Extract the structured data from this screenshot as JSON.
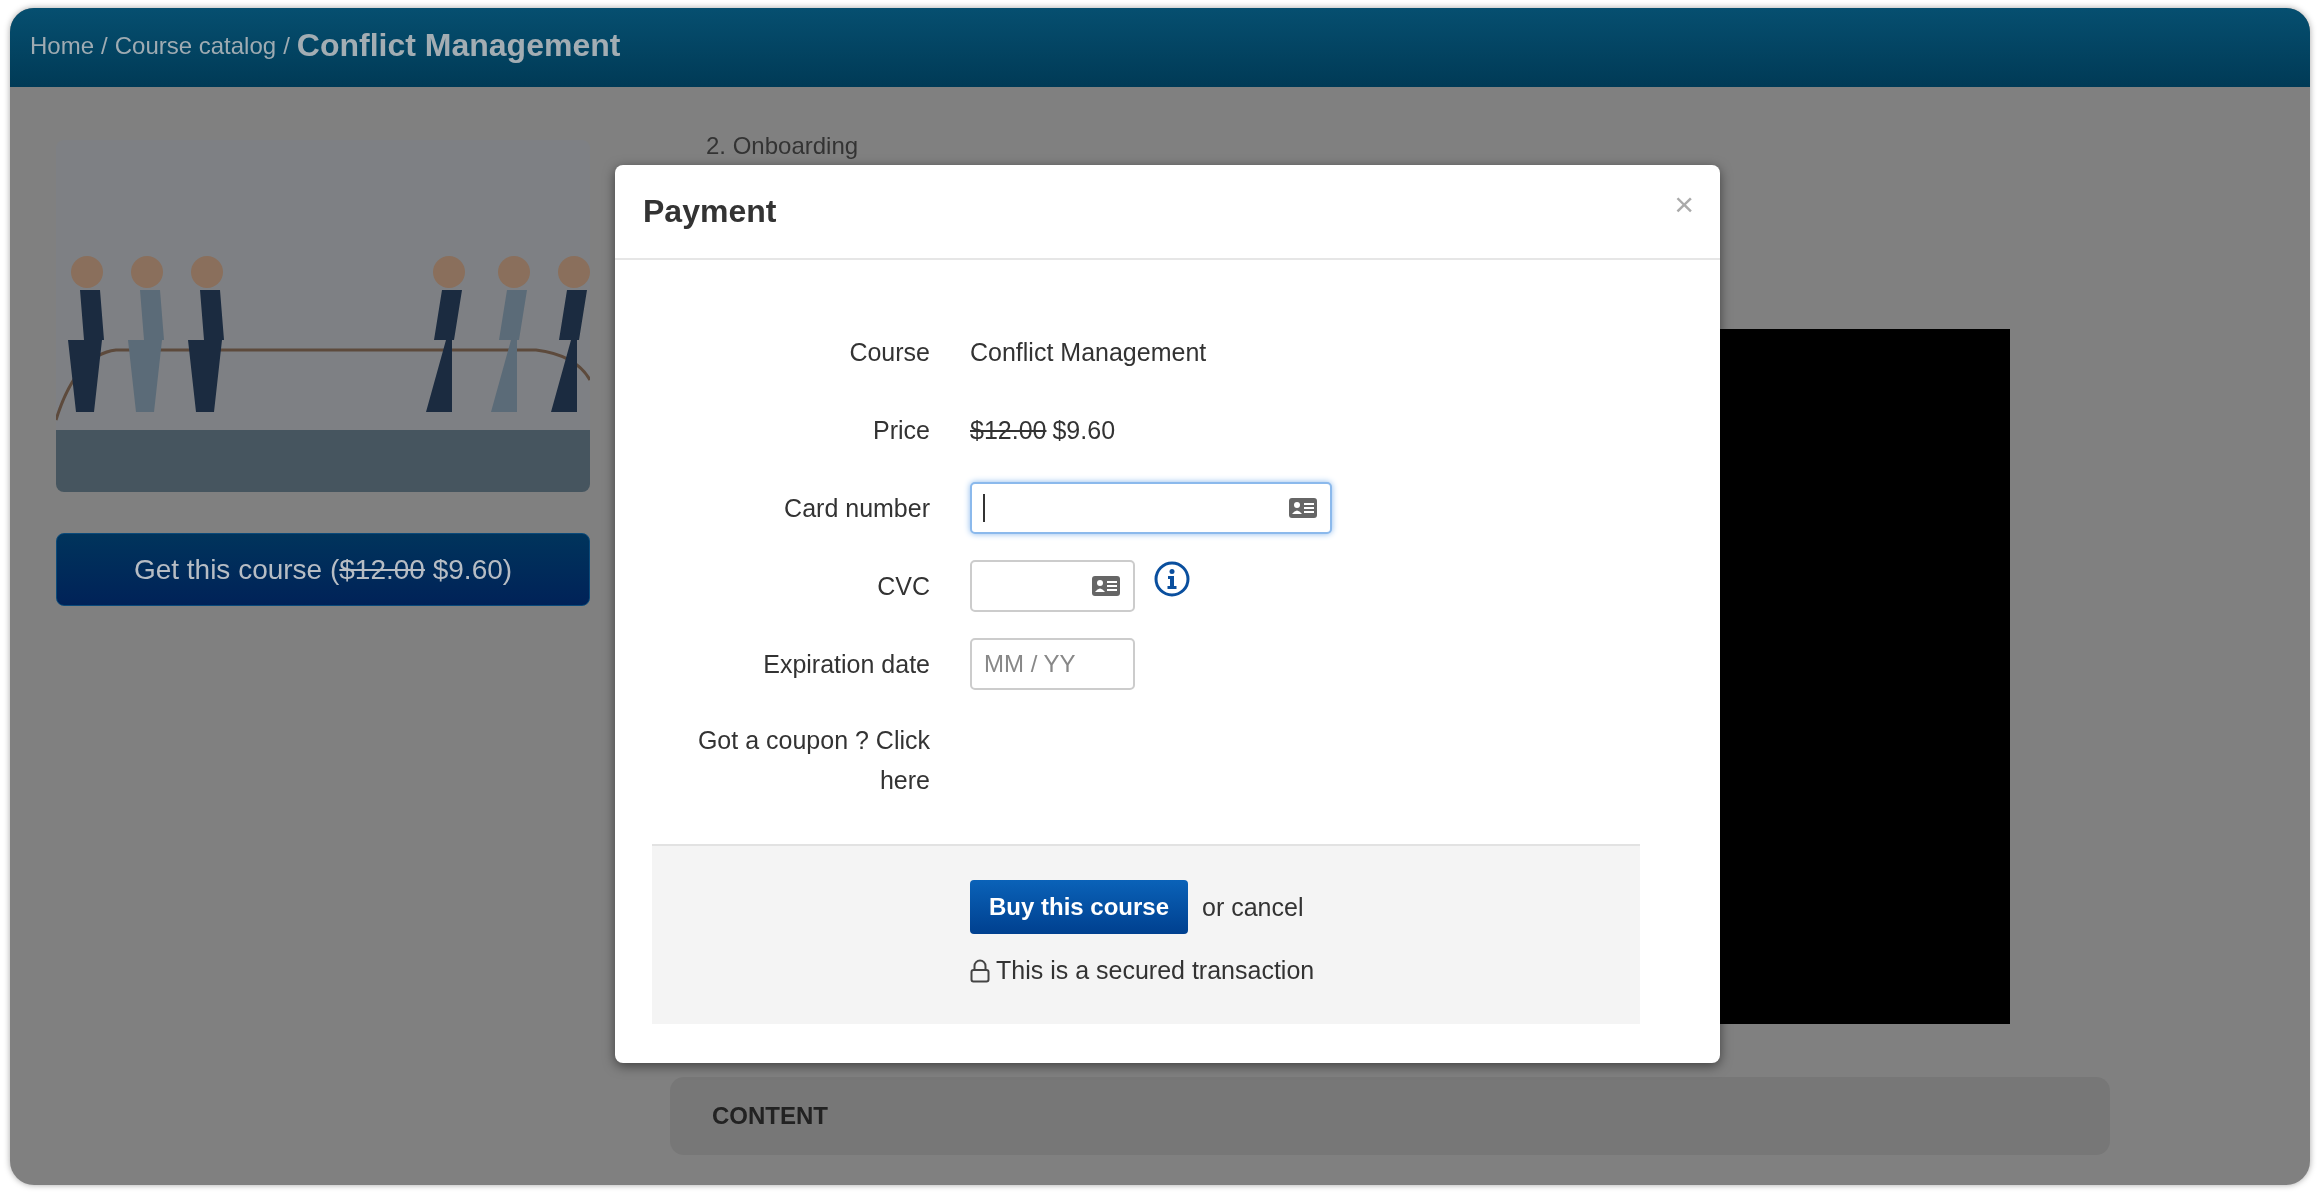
{
  "breadcrumb": {
    "items": [
      {
        "label": "Home",
        "separator": "/"
      },
      {
        "label": "Course catalog",
        "separator": "/"
      }
    ],
    "current": "Conflict Management"
  },
  "course_card": {
    "button": {
      "prefix": "Get this course (",
      "old_price": "$12.00",
      "new_price": "$9.60",
      "suffix": ")"
    }
  },
  "lesson": "2. Onboarding",
  "content_section": {
    "title": "CONTENT"
  },
  "payment_modal": {
    "title": "Payment",
    "close": "×",
    "rows": [
      {
        "kind": "text",
        "label": "Course",
        "value": "Conflict Management"
      },
      {
        "kind": "price",
        "label": "Price",
        "old_price": "$12.00",
        "new_price": "$9.60"
      },
      {
        "kind": "card_number",
        "label": "Card number",
        "focused": true
      },
      {
        "kind": "cvc",
        "label": "CVC",
        "focused": false
      },
      {
        "kind": "expiry",
        "label": "Expiration date",
        "focused": false,
        "placeholder": "MM / YY"
      },
      {
        "kind": "link",
        "label": "Got a coupon ? Click here"
      }
    ],
    "buy_button": "Buy this course",
    "cancel": "or cancel",
    "secure_note": "This is a secured transaction"
  }
}
